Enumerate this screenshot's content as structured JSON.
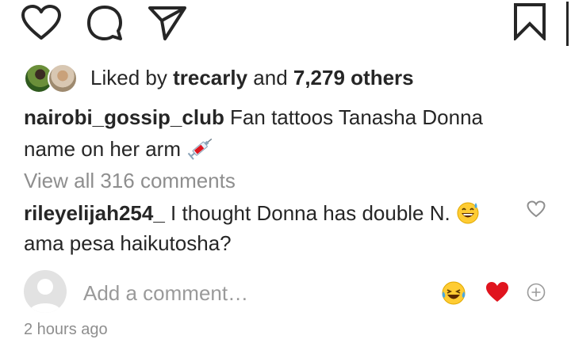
{
  "actions": {
    "like_icon": "heart-outline-icon",
    "comment_icon": "speech-bubble-icon",
    "share_icon": "paper-plane-icon",
    "save_icon": "bookmark-icon"
  },
  "likes": {
    "prefix": "Liked by ",
    "user": "trecarly",
    "middle": " and ",
    "count": "7,279 others"
  },
  "caption": {
    "username": "nairobi_gossip_club",
    "text": " Fan tattoos Tanasha Donna name on her arm",
    "emoji": "syringe-emoji"
  },
  "view_all_comments": "View all 316 comments",
  "comments": [
    {
      "username": "rileyelijah254_",
      "text_part1": " I thought Donna has double N.",
      "emoji": "grinning-sweat-emoji",
      "text_part2": "ama pesa haikutosha?"
    }
  ],
  "add_comment": {
    "placeholder": "Add a comment…",
    "quick_reactions": [
      "laughing-tears-emoji",
      "red-heart-emoji"
    ],
    "more_icon": "plus-circle-icon"
  },
  "time_ago": "2 hours ago",
  "colors": {
    "text": "#262626",
    "muted": "#8e8e8e",
    "heart_red": "#e0141e"
  }
}
